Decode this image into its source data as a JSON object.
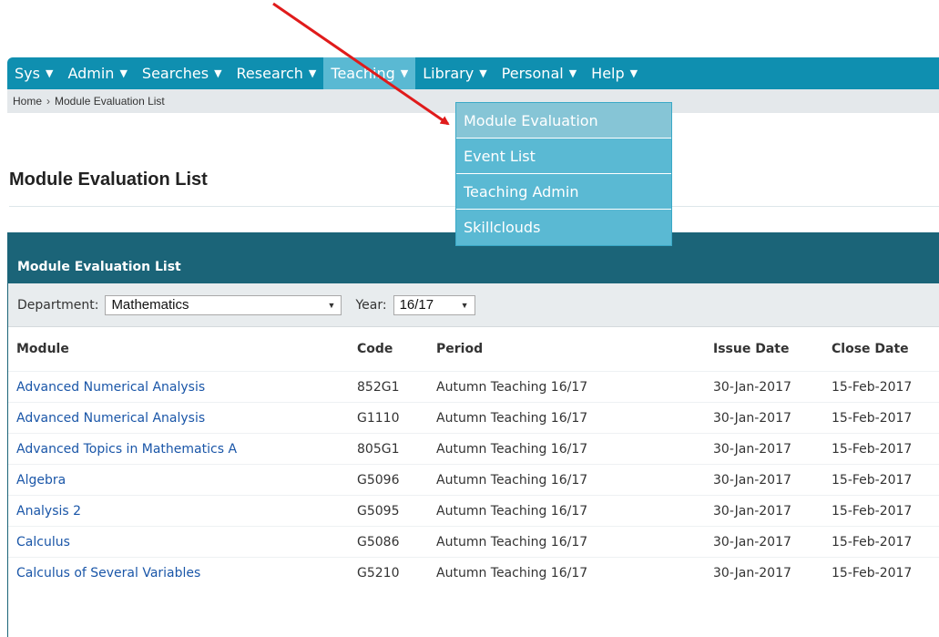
{
  "nav": {
    "items": [
      {
        "label": "Sys",
        "caret": "▼"
      },
      {
        "label": "Admin",
        "caret": "▼"
      },
      {
        "label": "Searches",
        "caret": "▼"
      },
      {
        "label": "Research",
        "caret": "▼"
      },
      {
        "label": "Teaching",
        "caret": "▼"
      },
      {
        "label": "Library",
        "caret": "▼"
      },
      {
        "label": "Personal",
        "caret": "▼"
      },
      {
        "label": "Help",
        "caret": "▼"
      }
    ],
    "active": "Teaching",
    "color": "#0f8fb0"
  },
  "breadcrumb": {
    "home": "Home",
    "separator": "›",
    "current": "Module Evaluation List"
  },
  "dropdown": {
    "items": [
      "Module Evaluation",
      "Event List",
      "Teaching Admin",
      "Skillclouds"
    ],
    "hovered": "Module Evaluation"
  },
  "page": {
    "title": "Module Evaluation List"
  },
  "panel": {
    "title": "Module Evaluation List",
    "color": "#1b6478",
    "filters": {
      "department_label": "Department:",
      "department_value": "Mathematics",
      "year_label": "Year:",
      "year_value": "16/17",
      "arrow": "▼"
    },
    "columns": [
      "Module",
      "Code",
      "Period",
      "Issue Date",
      "Close Date"
    ],
    "rows": [
      {
        "module": "Advanced Numerical Analysis",
        "code": "852G1",
        "period": "Autumn Teaching 16/17",
        "issue": "30-Jan-2017",
        "close": "15-Feb-2017"
      },
      {
        "module": "Advanced Numerical Analysis",
        "code": "G1110",
        "period": "Autumn Teaching 16/17",
        "issue": "30-Jan-2017",
        "close": "15-Feb-2017"
      },
      {
        "module": "Advanced Topics in Mathematics A",
        "code": "805G1",
        "period": "Autumn Teaching 16/17",
        "issue": "30-Jan-2017",
        "close": "15-Feb-2017"
      },
      {
        "module": "Algebra",
        "code": "G5096",
        "period": "Autumn Teaching 16/17",
        "issue": "30-Jan-2017",
        "close": "15-Feb-2017"
      },
      {
        "module": "Analysis 2",
        "code": "G5095",
        "period": "Autumn Teaching 16/17",
        "issue": "30-Jan-2017",
        "close": "15-Feb-2017"
      },
      {
        "module": "Calculus",
        "code": "G5086",
        "period": "Autumn Teaching 16/17",
        "issue": "30-Jan-2017",
        "close": "15-Feb-2017"
      },
      {
        "module": "Calculus of Several Variables",
        "code": "G5210",
        "period": "Autumn Teaching 16/17",
        "issue": "30-Jan-2017",
        "close": "15-Feb-2017"
      }
    ]
  },
  "annotation": {
    "arrow_color": "#e01b1b"
  }
}
